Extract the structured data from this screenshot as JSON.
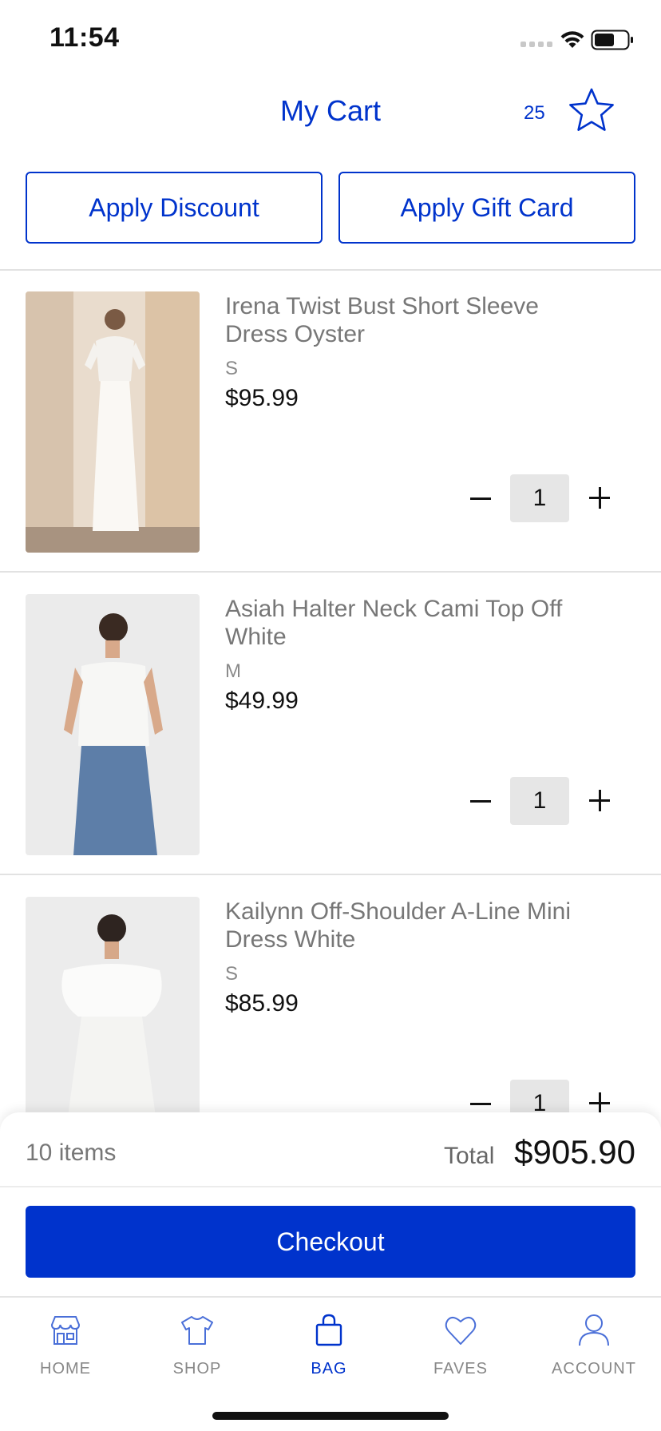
{
  "status_bar": {
    "time": "11:54"
  },
  "header": {
    "title": "My Cart",
    "points": "25"
  },
  "actions": {
    "discount_label": "Apply Discount",
    "gift_card_label": "Apply Gift Card"
  },
  "cart": {
    "items": [
      {
        "name": "Irena Twist Bust Short Sleeve Dress Oyster",
        "size": "S",
        "price": "$95.99",
        "quantity": "1"
      },
      {
        "name": "Asiah Halter Neck Cami Top Off White",
        "size": "M",
        "price": "$49.99",
        "quantity": "1"
      },
      {
        "name": "Kailynn Off-Shoulder A-Line Mini Dress White",
        "size": "S",
        "price": "$85.99",
        "quantity": "1"
      }
    ]
  },
  "summary": {
    "items_count": "10 items",
    "total_label": "Total",
    "total_value": "$905.90",
    "checkout_label": "Checkout"
  },
  "tab_bar": {
    "tabs": [
      {
        "label": "HOME",
        "icon": "storefront-icon"
      },
      {
        "label": "SHOP",
        "icon": "shirt-icon"
      },
      {
        "label": "BAG",
        "icon": "bag-icon"
      },
      {
        "label": "FAVES",
        "icon": "heart-icon"
      },
      {
        "label": "ACCOUNT",
        "icon": "person-icon"
      }
    ],
    "active": "BAG"
  },
  "colors": {
    "accent": "#0033cc",
    "text_muted": "#777777",
    "divider": "#e2e2e2",
    "qty_bg": "#e6e6e6"
  }
}
